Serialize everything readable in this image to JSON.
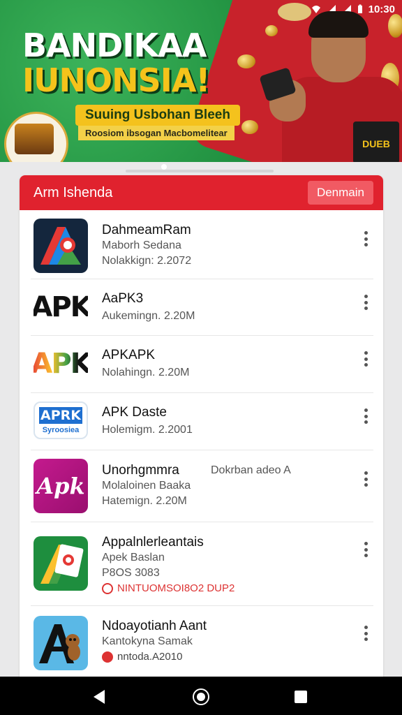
{
  "status_bar": {
    "time": "10:30"
  },
  "banner": {
    "headline_line1": "BANDIKAA",
    "headline_line2": "IUNONSIA!",
    "subtitle": "Suuing Usbohan Bleeh",
    "tagline": "Roosiom ibsogan Macbomelitear",
    "laptop_text": "DUEB"
  },
  "card": {
    "title": "Arm Ishenda",
    "header_button": "Denmain"
  },
  "apps": [
    {
      "name": "DahmeamRam",
      "line2": "Maborh Sedana",
      "line3": "Nolakkign: 2.2072",
      "icon": "app-a-icon"
    },
    {
      "name": "AaPK3",
      "line2": "Aukemingn. 2.20M",
      "icon": "apk-logo-icon",
      "icon_text": "APK"
    },
    {
      "name": "APKAPK",
      "line2": "Nolahingn. 2.20M",
      "icon": "apk-colorful-logo-icon",
      "icon_text": "APK"
    },
    {
      "name": "APK Daste",
      "line2": "Holemigm. 2.2001",
      "icon": "apk-blue-logo-icon",
      "icon_text": "APRK",
      "icon_subtext": "Syroosiea"
    },
    {
      "name": "Unorhgmmra",
      "line2": "Molaloinen Baaka",
      "line3": "Hatemign. 2.20M",
      "tag": "Dokrban adeo A",
      "icon": "apk-magenta-logo-icon",
      "icon_text": "Apk"
    },
    {
      "name": "Appalnlerleantais",
      "line2": "Apek Baslan",
      "line3": "P8OS 3083",
      "line4": "NINTUOMSOI8O2 DUP2",
      "icon": "app-green-a-icon"
    },
    {
      "name": "Ndoayotianh Aant",
      "line2": "Kantokyna Samak",
      "line3": "nntoda.A2010",
      "icon": "app-monkey-a-icon"
    }
  ],
  "colors": {
    "header_red": "#e0222e",
    "banner_green": "#1f8f3f",
    "banner_yellow": "#f5c31b"
  }
}
